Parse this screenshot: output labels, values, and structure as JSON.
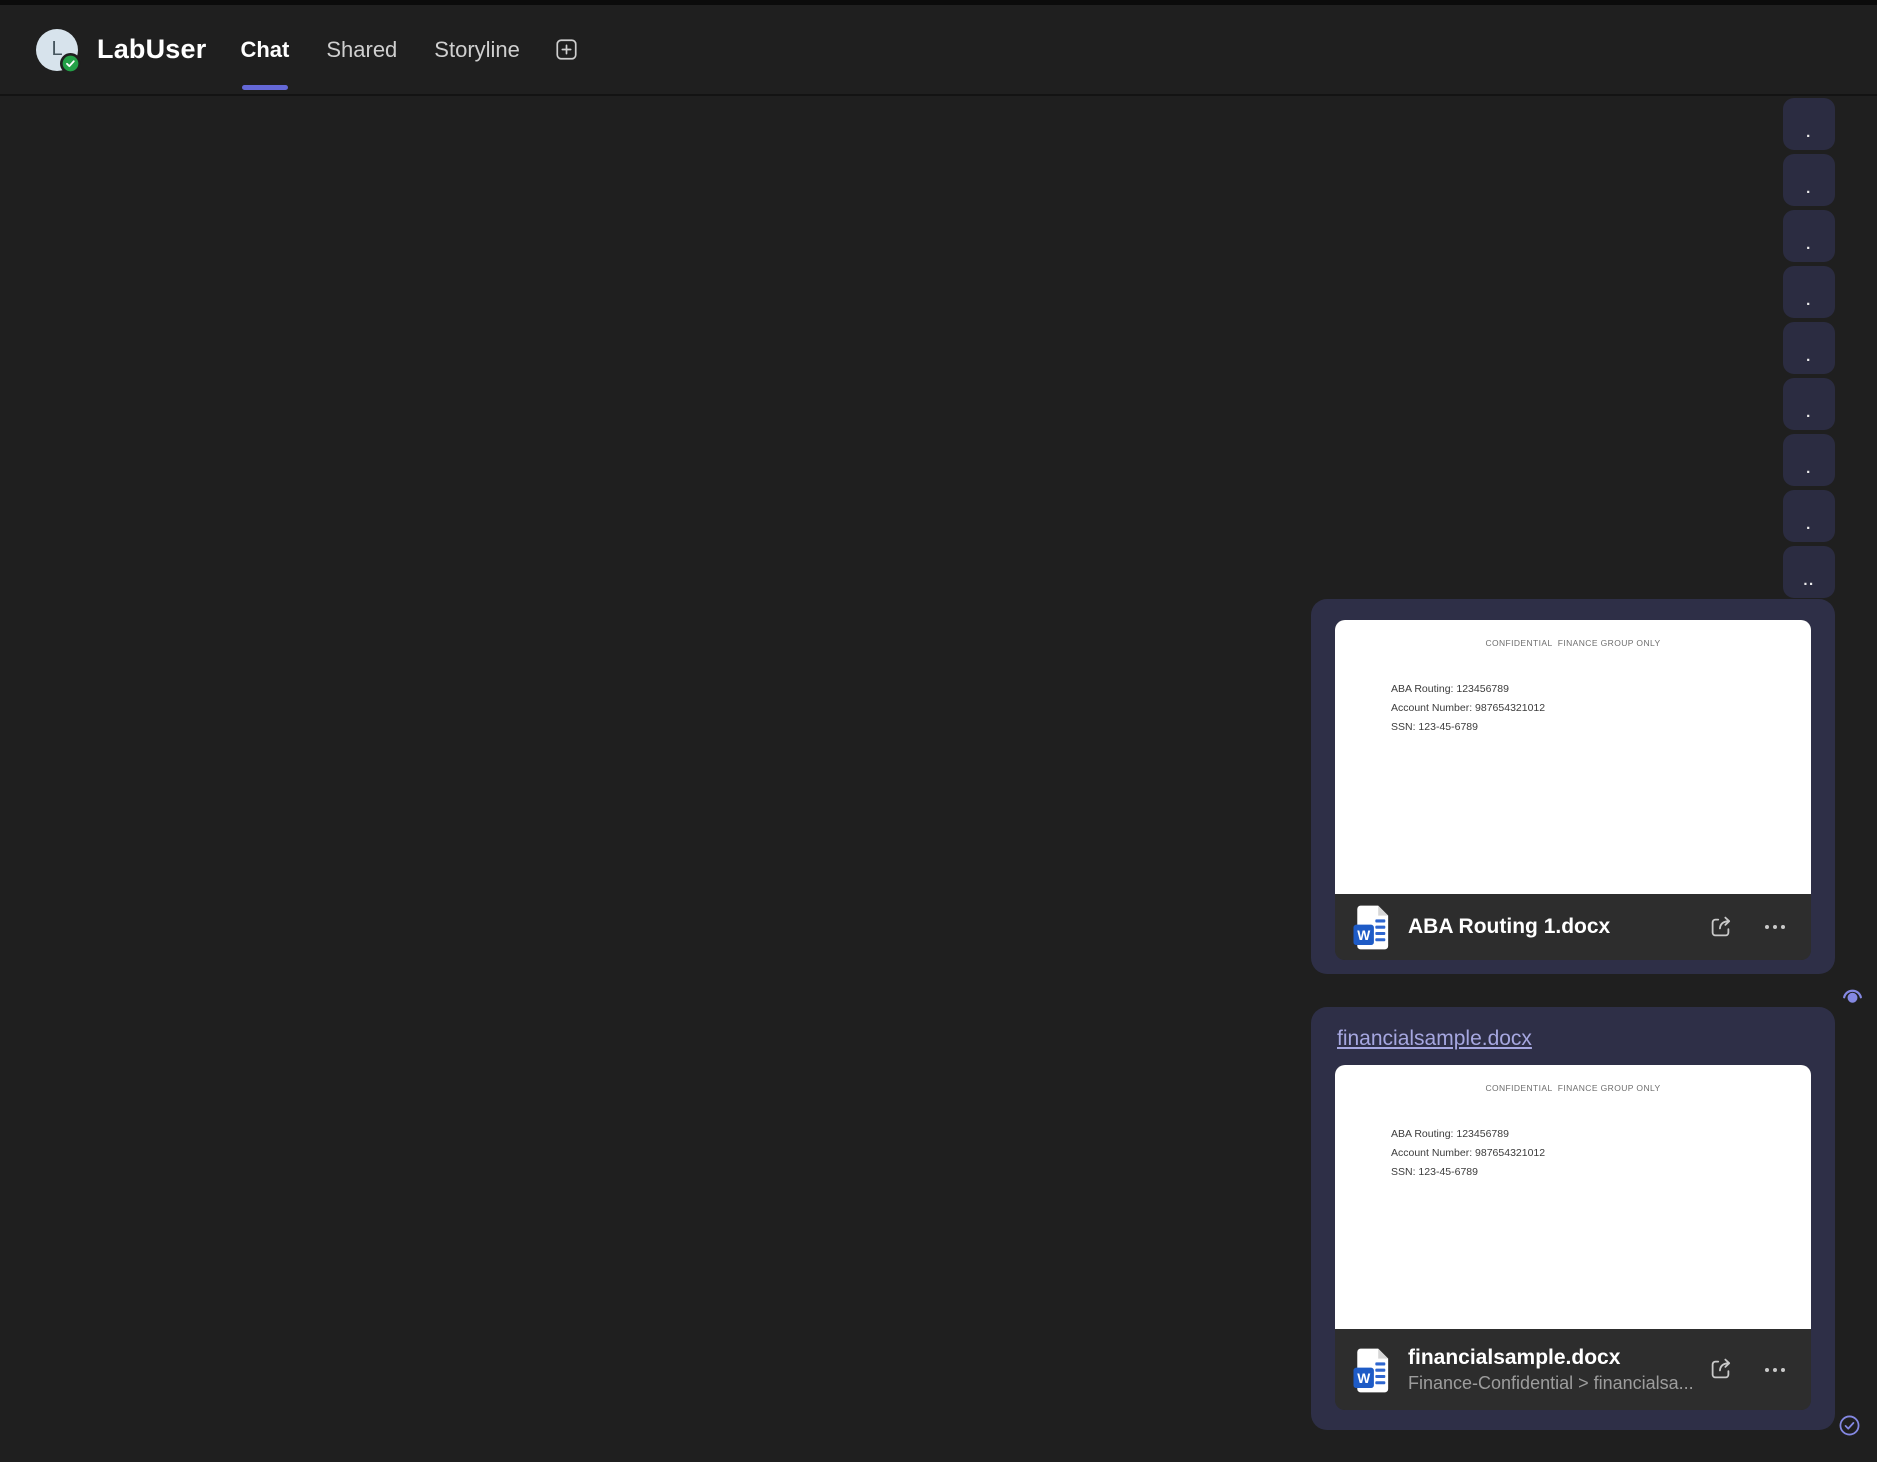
{
  "header": {
    "app_user": "LabUser",
    "avatar_initial": "L",
    "presence": "available",
    "tabs": [
      {
        "label": "Chat",
        "active": true
      },
      {
        "label": "Shared",
        "active": false
      },
      {
        "label": "Storyline",
        "active": false
      }
    ]
  },
  "right_rail": {
    "tiles": [
      ".",
      ".",
      ".",
      ".",
      ".",
      ".",
      ".",
      ".",
      ".."
    ]
  },
  "conversation": {
    "messages": [
      {
        "kind": "file-attachment",
        "file": {
          "name": "ABA Routing 1.docx",
          "type": "Word document",
          "preview": {
            "banner": "CONFIDENTIAL  FINANCE GROUP ONLY",
            "lines": [
              "ABA Routing: 123456789",
              "Account Number: 987654321012",
              "SSN: 123-45-6789"
            ]
          }
        },
        "receipt": "read"
      },
      {
        "kind": "link-and-file-attachment",
        "link_text": "financialsample.docx",
        "file": {
          "name": "financialsample.docx",
          "location": "Finance-Confidential > financialsa...",
          "type": "Word document",
          "preview": {
            "banner": "CONFIDENTIAL  FINANCE GROUP ONLY",
            "lines": [
              "ABA Routing: 123456789",
              "Account Number: 987654321012",
              "SSN: 123-45-6789"
            ]
          }
        },
        "receipt": "sent"
      }
    ]
  },
  "colors": {
    "accent": "#6468d7",
    "bubble": "#2e2f47",
    "rail_tile": "#2b2c41",
    "link": "#a6a7e0",
    "presence_green": "#23a047",
    "word_blue": "#1e5bc6",
    "background": "#1f1f1f"
  }
}
